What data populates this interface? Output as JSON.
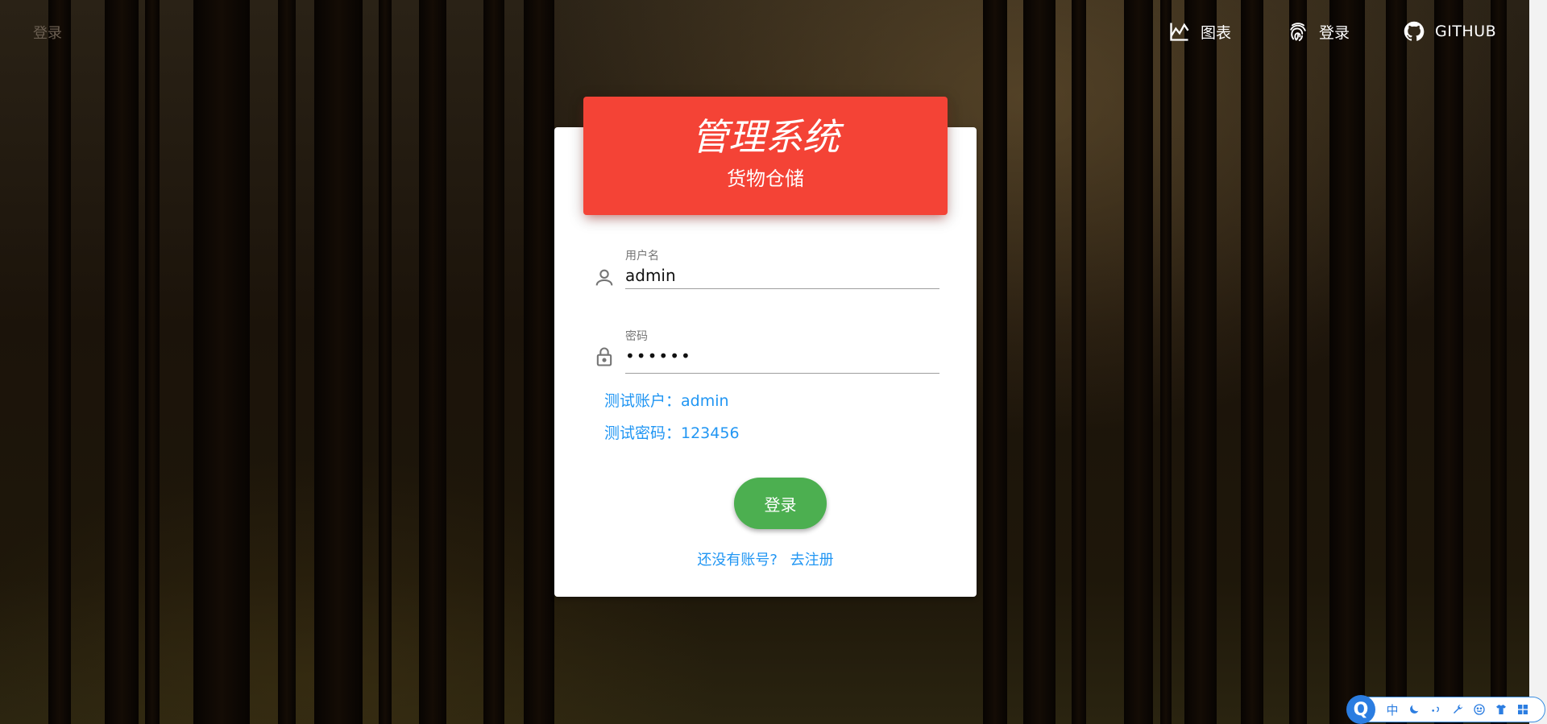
{
  "app": {
    "brand": "登录"
  },
  "nav": {
    "items": [
      {
        "label": "图表",
        "icon": "chart-icon"
      },
      {
        "label": "登录",
        "icon": "fingerprint-icon"
      },
      {
        "label": "GITHUB",
        "icon": "github-icon"
      }
    ]
  },
  "card": {
    "title": "管理系统",
    "subtitle": "货物仓储",
    "header_color": "#f44336"
  },
  "form": {
    "username": {
      "label": "用户名",
      "value": "admin",
      "icon": "person-icon"
    },
    "password": {
      "label": "密码",
      "value": "••••••",
      "icon": "lock-icon"
    },
    "hint_account": "测试账户：admin",
    "hint_password": "测试密码：123456",
    "submit_label": "登录",
    "register_prompt": "还没有账号?",
    "register_link": "去注册"
  },
  "colors": {
    "accent": "#2196f3",
    "submit": "#4caf50"
  },
  "ime": {
    "logo": "Q",
    "items": [
      "中",
      "moon-icon",
      "punctuation-icon",
      "wrench-icon",
      "smile-icon",
      "shirt-icon",
      "grid-icon"
    ],
    "mode_label": "中"
  }
}
